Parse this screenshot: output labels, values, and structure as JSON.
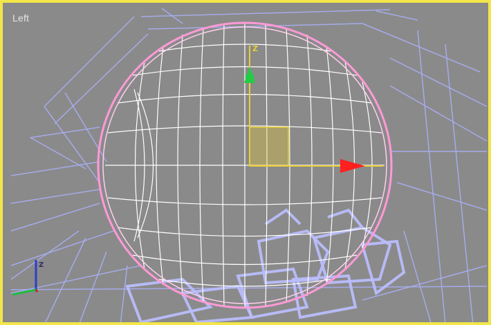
{
  "viewport": {
    "label": "Left",
    "border_color": "#f3e64a",
    "background_color": "#8a8a8a"
  },
  "gizmo": {
    "up_axis_label": "Z",
    "up_axis_color": "#22cc44",
    "right_axis_color": "#ff2020",
    "plane_color": "#e8cf33"
  },
  "axis_tripod": {
    "vertical_label": "Z",
    "colors": {
      "vertical": "#2b3ec9",
      "horizontal": "#20bb40",
      "depth": "#cc2020"
    }
  },
  "colors": {
    "background_wire": "#a9aef4",
    "sphere_wire": "#ffffff",
    "sphere_outline": "#ff9ad7"
  }
}
